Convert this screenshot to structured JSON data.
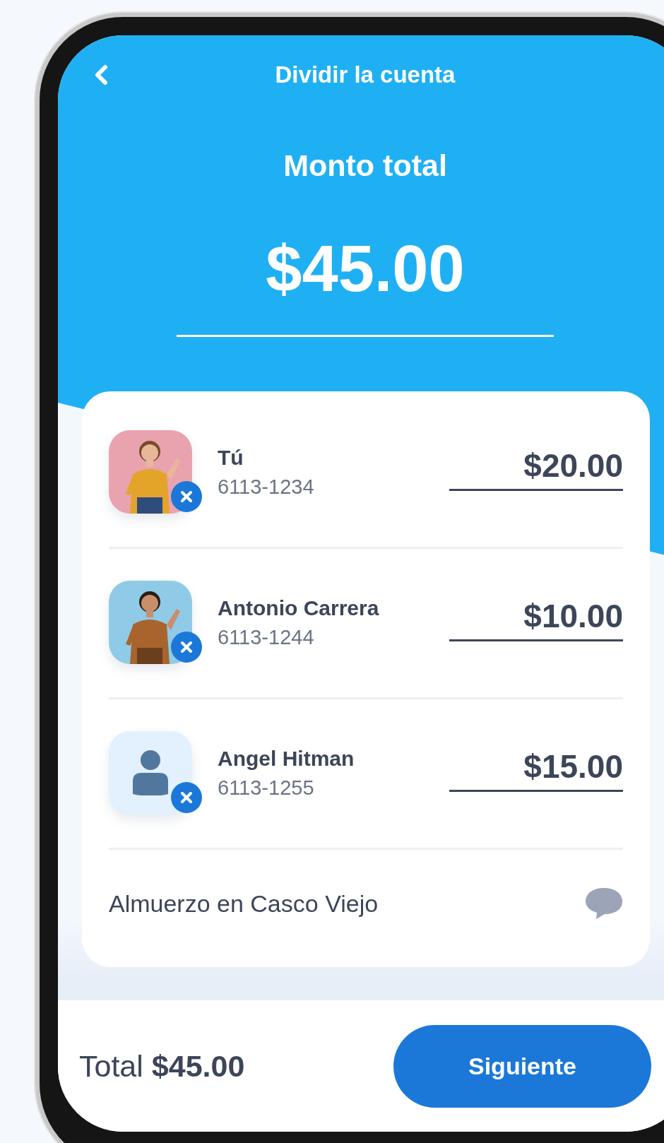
{
  "header": {
    "title": "Dividir la cuenta"
  },
  "total_label": "Monto total",
  "total_amount": "$45.00",
  "participants": [
    {
      "name": "Tú",
      "phone": "6113-1234",
      "amount": "$20.00"
    },
    {
      "name": "Antonio Carrera",
      "phone": "6113-1244",
      "amount": "$10.00"
    },
    {
      "kind": "placeholder",
      "name": "Angel Hitman",
      "phone": "6113-1255",
      "amount": "$15.00"
    }
  ],
  "note": "Almuerzo en Casco Viejo",
  "footer": {
    "total_label": "Total",
    "total_amount": "$45.00",
    "button": "Siguiente"
  }
}
